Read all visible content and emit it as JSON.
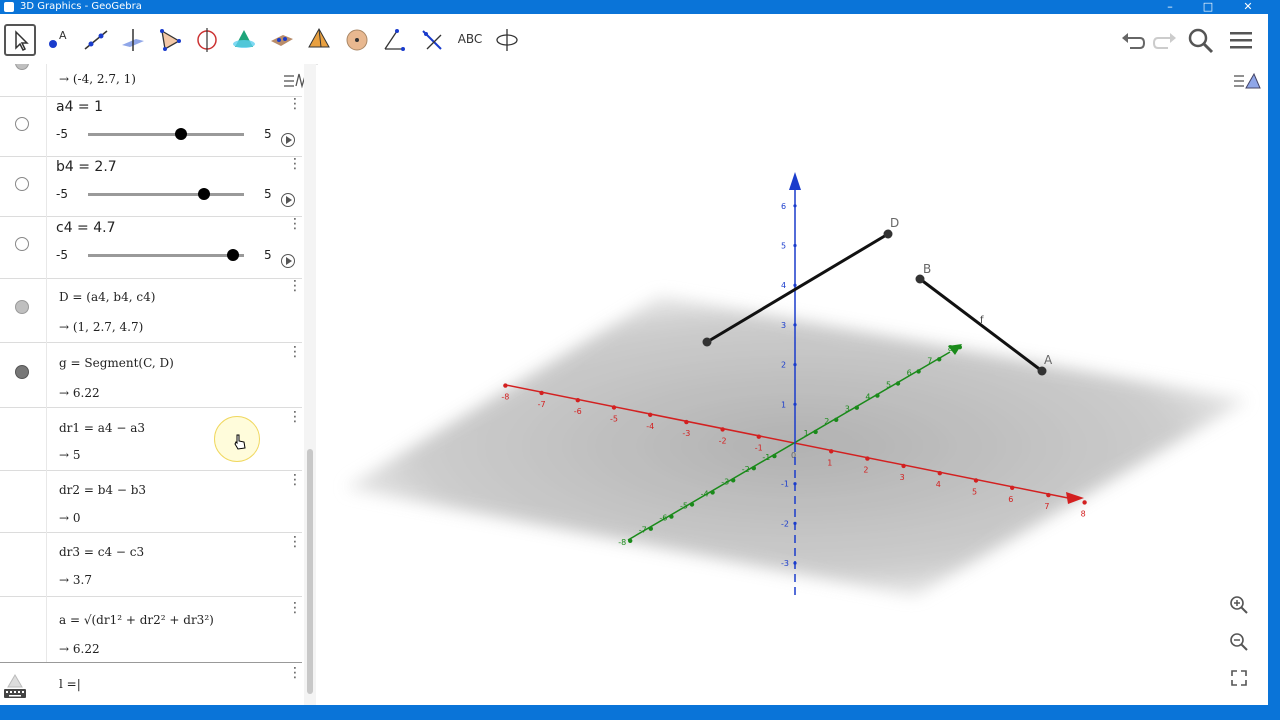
{
  "window": {
    "title": "3D Graphics - GeoGebra",
    "minimize": "–",
    "maximize": "□",
    "close": "✕"
  },
  "toolbar": {
    "tools": [
      {
        "name": "move-tool-icon",
        "selected": true
      },
      {
        "name": "point-tool-icon"
      },
      {
        "name": "line-tool-icon"
      },
      {
        "name": "perpendicular-line-icon"
      },
      {
        "name": "polygon-tool-icon"
      },
      {
        "name": "circle-axis-icon"
      },
      {
        "name": "intersect-surfaces-icon"
      },
      {
        "name": "plane-tool-icon"
      },
      {
        "name": "pyramid-tool-icon"
      },
      {
        "name": "sphere-tool-icon"
      },
      {
        "name": "angle-tool-icon"
      },
      {
        "name": "reflect-tool-icon"
      },
      {
        "name": "text-tool-icon",
        "text": "ABC"
      },
      {
        "name": "rotate-view-icon"
      }
    ]
  },
  "algebra": {
    "top_output": "→ (-4, 2.7, 1)",
    "sliders": [
      {
        "label": "a4 = 1",
        "min": "-5",
        "max": "5",
        "value": 1
      },
      {
        "label": "b4 = 2.7",
        "min": "-5",
        "max": "5",
        "value": 2.7
      },
      {
        "label": "c4 = 4.7",
        "min": "-5",
        "max": "5",
        "value": 4.7
      }
    ],
    "rows": [
      {
        "def": "D = (a4, b4, c4)",
        "out": "→ (1, 2.7, 4.7)"
      },
      {
        "def": "g = Segment(C, D)",
        "out": "→ 6.22"
      },
      {
        "def": "dr1 = a4 − a3",
        "out": "→ 5"
      },
      {
        "def": "dr2 = b4 − b3",
        "out": "→ 0"
      },
      {
        "def": "dr3 = c4 − c3",
        "out": "→ 3.7"
      },
      {
        "def": "a = √(dr1² + dr2² + dr3²)",
        "out": "→ 6.22"
      }
    ],
    "input": "l =|"
  },
  "graphics": {
    "x_ticks": [
      "-8",
      "-7",
      "-6",
      "-5",
      "-4",
      "-3",
      "-2",
      "-1",
      "0",
      "1",
      "2",
      "3",
      "4",
      "5",
      "6",
      "7",
      "8"
    ],
    "y_ticks": [
      "-8",
      "-7",
      "-6",
      "-5",
      "-4",
      "-3",
      "-2",
      "-1",
      "1",
      "2",
      "3",
      "4",
      "5",
      "6",
      "7",
      "8"
    ],
    "z_ticks": [
      "-3",
      "-2",
      "-1",
      "1",
      "2",
      "3",
      "4",
      "5",
      "6"
    ],
    "points": {
      "A": "A",
      "B": "B",
      "D": "D",
      "f": "f"
    },
    "colors": {
      "x_axis": "#d32020",
      "y_axis": "#1a8a1a",
      "z_axis": "#1a3ccc",
      "segment": "#111111"
    }
  }
}
